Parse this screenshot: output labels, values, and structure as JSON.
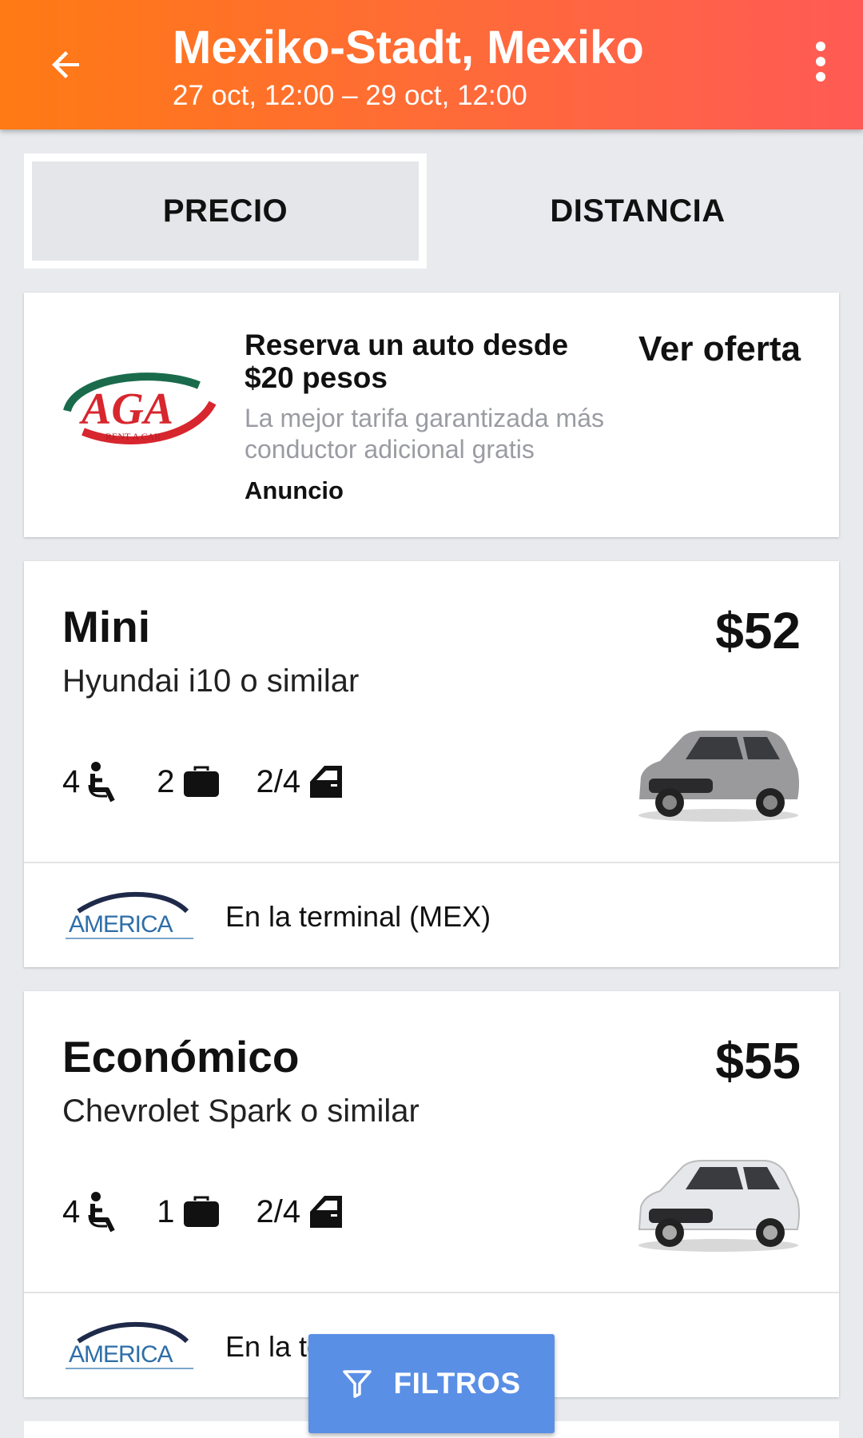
{
  "header": {
    "title": "Mexiko-Stadt, Mexiko",
    "subtitle": "27 oct, 12:00 – 29 oct, 12:00",
    "back_icon": "arrow-left-icon",
    "menu_icon": "more-vertical-icon"
  },
  "sort_tabs": [
    {
      "label": "PRECIO",
      "selected": true
    },
    {
      "label": "DISTANCIA",
      "selected": false
    }
  ],
  "ad": {
    "logo_text": "AGA",
    "logo_sub": "RENT A CAR",
    "headline": "Reserva un auto desde $20 pesos",
    "description": "La mejor tarifa garantizada más conductor adicional gratis",
    "label": "Anuncio",
    "cta": "Ver oferta"
  },
  "cars": [
    {
      "category": "Mini",
      "model": "Hyundai i10 o similar",
      "price": "$52",
      "seats": "4",
      "bags": "2",
      "doors": "2/4",
      "vendor_logo": "AMERICA",
      "location": "En la terminal (MEX)",
      "car_color": "#9a9a9c"
    },
    {
      "category": "Económico",
      "model": "Chevrolet Spark o similar",
      "price": "$55",
      "seats": "4",
      "bags": "1",
      "doors": "2/4",
      "vendor_logo": "AMERICA",
      "location": "En la terminal (MEX)",
      "car_color": "#e6e7ea"
    }
  ],
  "filter_button": {
    "label": "FILTROS",
    "icon": "filter-icon"
  },
  "colors": {
    "header_start": "#ff7a14",
    "header_end": "#ff5a55",
    "filter": "#5a8fe6",
    "ad_desc": "#9a9ca2"
  }
}
